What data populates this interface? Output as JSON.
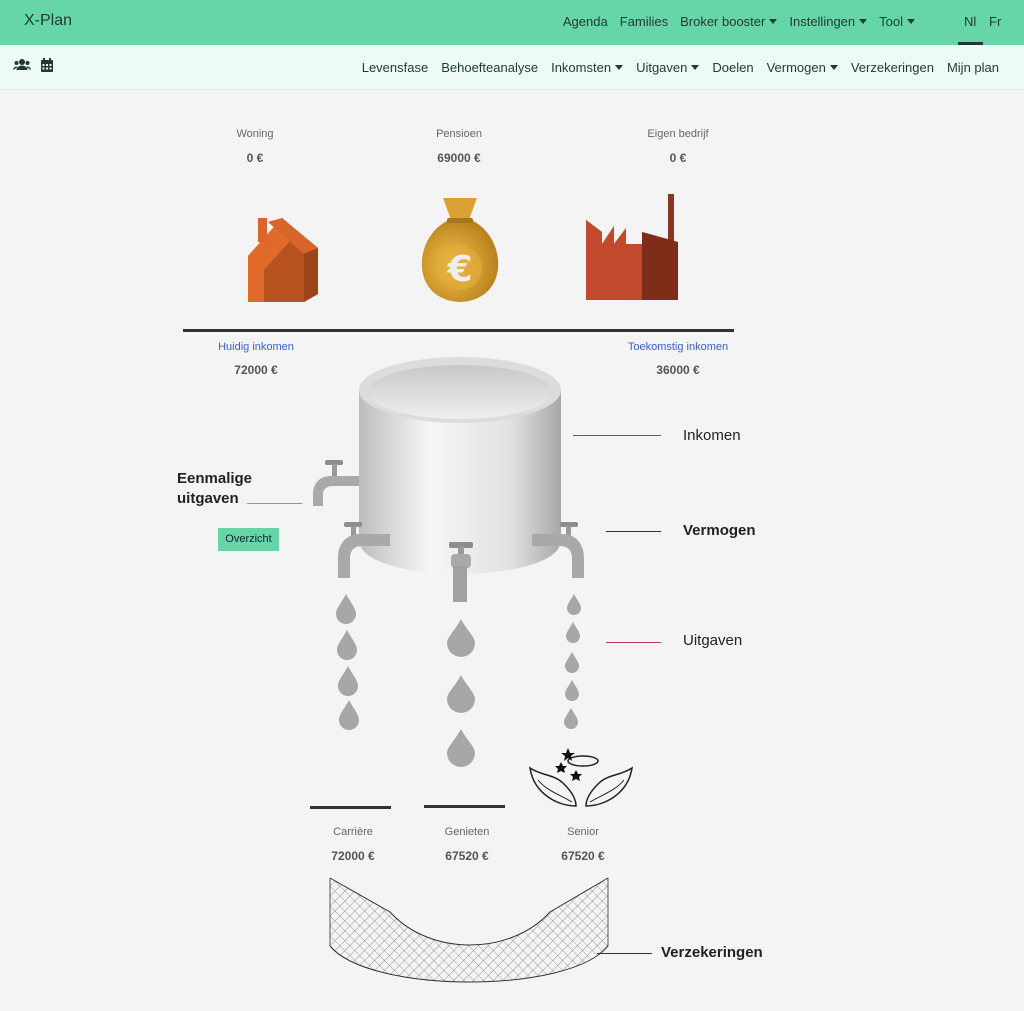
{
  "app": {
    "brand": "X-Plan"
  },
  "topnav": {
    "agenda": "Agenda",
    "families": "Families",
    "broker_booster": "Broker booster",
    "instellingen": "Instellingen",
    "tool": "Tool",
    "lang_nl": "Nl",
    "lang_fr": "Fr"
  },
  "subnav": {
    "levensfase": "Levensfase",
    "behoefteanalyse": "Behoefteanalyse",
    "inkomsten": "Inkomsten",
    "uitgaven": "Uitgaven",
    "doelen": "Doelen",
    "vermogen": "Vermogen",
    "verzekeringen": "Verzekeringen",
    "mijn_plan": "Mijn plan",
    "icons": [
      "users-icon",
      "calendar-icon"
    ]
  },
  "assets": {
    "woning": {
      "label": "Woning",
      "value": "0 €"
    },
    "pensioen": {
      "label": "Pensioen",
      "value": "69000 €"
    },
    "eigen_bedrijf": {
      "label": "Eigen bedrijf",
      "value": "0 €"
    }
  },
  "income": {
    "current_label": "Huidig inkomen",
    "current_value": "72000 €",
    "future_label": "Toekomstig inkomen",
    "future_value": "36000 €"
  },
  "diagram": {
    "inkomen_label": "Inkomen",
    "eenmalige_label_1": "Eenmalige",
    "eenmalige_label_2": "uitgaven",
    "overzicht_button": "Overzicht",
    "vermogen_label": "Vermogen",
    "uitgaven_label": "Uitgaven",
    "verzekeringen_label": "Verzekeringen"
  },
  "phases": {
    "carriere": {
      "label": "Carrière",
      "value": "72000 €"
    },
    "genieten": {
      "label": "Genieten",
      "value": "67520 €"
    },
    "senior": {
      "label": "Senior",
      "value": "67520 €"
    }
  },
  "colors": {
    "nav_green": "#66d6a8",
    "subbar": "#eefaf4",
    "inkomen_line": "#3a5fcd",
    "uitgaven_line": "#c0394f",
    "eenmalige_line": "#5fbf4a"
  }
}
